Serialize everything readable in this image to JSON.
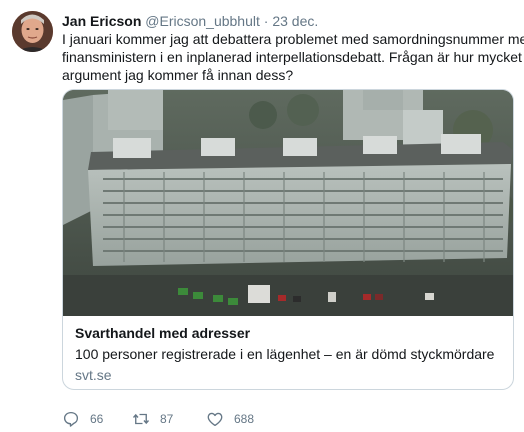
{
  "tweet": {
    "author_name": "Jan Ericson",
    "author_handle": "@Ericson_ubbhult",
    "separator": "·",
    "date": "23 dec.",
    "text_lines": [
      "I januari kommer jag att debattera problemet med samordningsnummer med",
      "finansministern i en inplanerad  interpellationsdebatt. Frågan är hur mycket fler",
      "argument jag kommer få innan dess?"
    ]
  },
  "card": {
    "title": "Svarthandel med adresser",
    "description": "100 personer registrerade i en lägenhet – en är dömd styckmördare",
    "domain": "svt.se",
    "image_icon": "aerial-apartment-building-photo"
  },
  "actions": {
    "reply": {
      "icon": "reply-icon",
      "count": "66"
    },
    "retweet": {
      "icon": "retweet-icon",
      "count": "87"
    },
    "like": {
      "icon": "heart-icon",
      "count": "688"
    }
  },
  "colors": {
    "text": "#14171a",
    "secondary": "#657786",
    "border": "#ccd6dd"
  }
}
